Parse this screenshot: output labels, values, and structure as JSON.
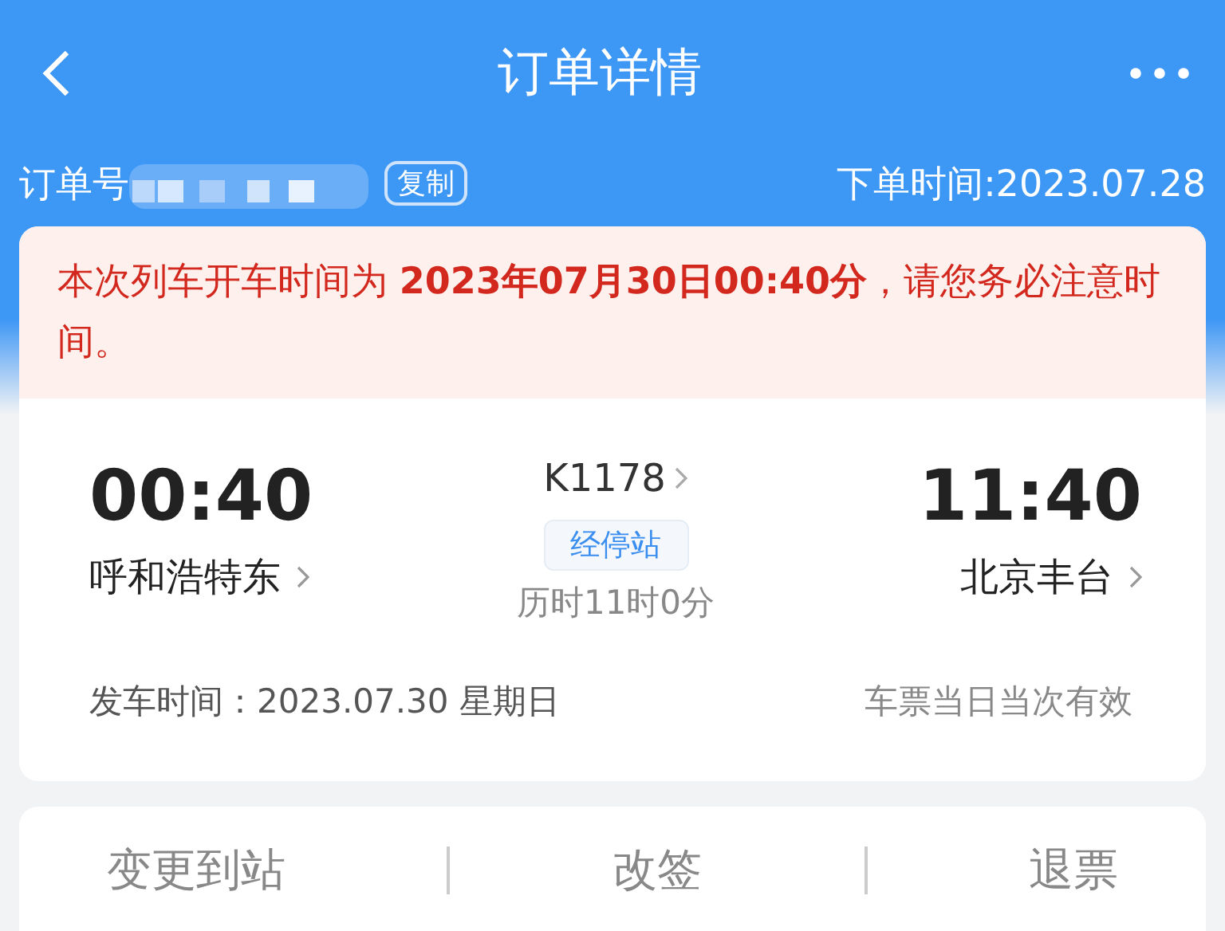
{
  "header": {
    "title": "订单详情"
  },
  "order": {
    "label": "订单号",
    "copy_button": "复制",
    "time": "下单时间:2023.07.28"
  },
  "notice": {
    "text": "本次列车开车时间为 **2023年07月30日00:40分**，请您务必注意时间。"
  },
  "trip": {
    "depart_time": "00:40",
    "depart_station": "呼和浩特东",
    "train": "K1178",
    "stops_button": "经停站",
    "duration": "历时11时0分",
    "arrive_time": "11:40",
    "arrive_station": "北京丰台",
    "date": "发车时间：2023.07.30 星期日",
    "validity": "车票当日当次有效"
  },
  "actions": [
    "变更到站",
    "改签",
    "退票"
  ]
}
